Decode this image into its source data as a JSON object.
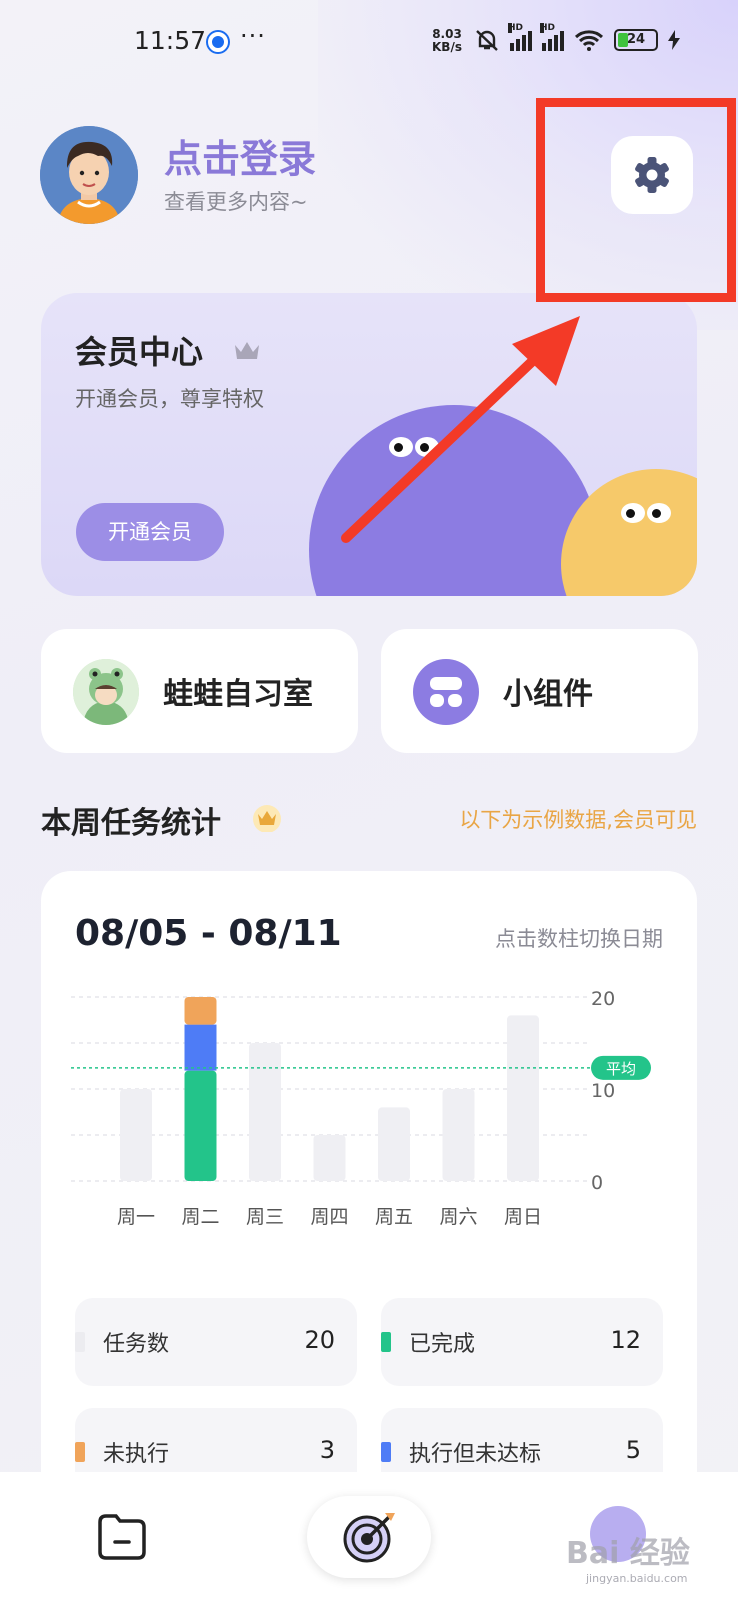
{
  "status_bar": {
    "time": "11:57",
    "more": "···",
    "speed_top": "8.03",
    "speed_bottom": "KB/s",
    "battery": "24",
    "hd": "HD"
  },
  "profile": {
    "login_title": "点击登录",
    "login_sub": "查看更多内容~"
  },
  "member": {
    "title": "会员中心",
    "subtitle": "开通会员，尊享特权",
    "button": "开通会员"
  },
  "tiles": {
    "study_room": "蛙蛙自习室",
    "widget": "小组件"
  },
  "weekly": {
    "title": "本周任务统计",
    "note": "以下为示例数据,会员可见",
    "range": "08/05 - 08/11",
    "hint": "点击数柱切换日期"
  },
  "chart_data": {
    "type": "bar",
    "categories": [
      "周一",
      "周二",
      "周三",
      "周四",
      "周五",
      "周六",
      "周日"
    ],
    "values": [
      10,
      20,
      15,
      5,
      8,
      10,
      18
    ],
    "series": [
      {
        "name": "已完成",
        "values": [
          0,
          12,
          0,
          0,
          0,
          0,
          0
        ]
      },
      {
        "name": "执行但未达标",
        "values": [
          0,
          5,
          0,
          0,
          0,
          0,
          0
        ]
      },
      {
        "name": "未执行",
        "values": [
          0,
          3,
          0,
          0,
          0,
          0,
          0
        ]
      }
    ],
    "ylim": [
      0,
      20
    ],
    "yticks": [
      "0",
      "10",
      "20"
    ],
    "average": 12.3,
    "average_label": "平均",
    "grid": true
  },
  "stats": [
    {
      "label": "任务数",
      "value": "20",
      "color": "#ececf0"
    },
    {
      "label": "已完成",
      "value": "12",
      "color": "#23c48a"
    },
    {
      "label": "未执行",
      "value": "3",
      "color": "#f0a45a"
    },
    {
      "label": "执行但未达标",
      "value": "5",
      "color": "#4e7cf6"
    }
  ],
  "colors": {
    "accent": "#8a79d8",
    "highlight": "#f33a27",
    "completed": "#23c48a",
    "partial": "#4e7cf6",
    "missed": "#f0a45a",
    "gold": "#e9a545"
  },
  "icons": {
    "settings": "gear-icon",
    "annotation": "red-arrow-icon",
    "tab_home": "folder-icon",
    "tab_focus": "target-icon",
    "tab_profile": "face-icon"
  },
  "watermark": {
    "main": "Bai 经验",
    "sub": "jingyan.baidu.com"
  }
}
